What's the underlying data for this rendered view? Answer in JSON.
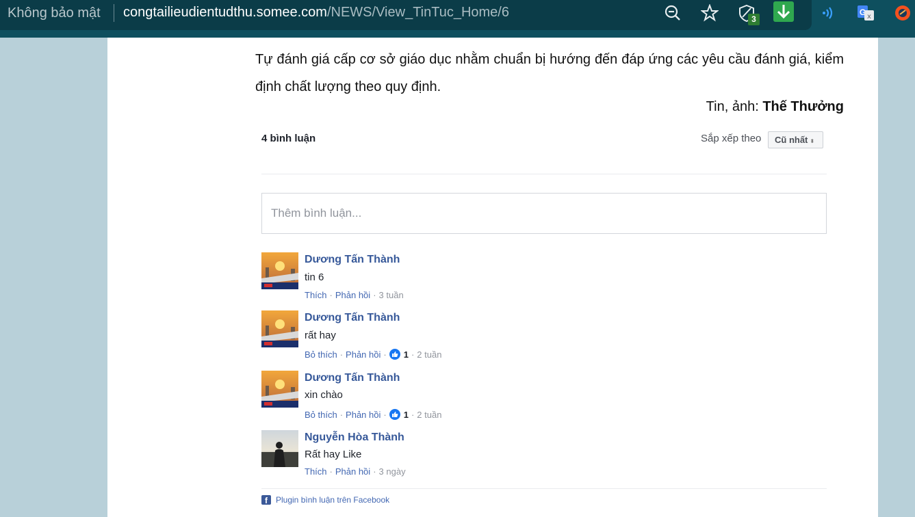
{
  "browser": {
    "security_label": "Không bảo mật",
    "url_host": "congtailieudientudthu.somee.com",
    "url_path": "/NEWS/View_TinTuc_Home/6",
    "extension_badge": "3",
    "icons": [
      "zoom-out-icon",
      "star-icon",
      "shield-icon",
      "download-icon",
      "wifi-icon",
      "translate-icon",
      "profile-icon"
    ]
  },
  "article": {
    "text": "Tự đánh giá cấp cơ sở giáo dục nhằm chuẩn bị hướng đến đáp ứng các yêu cầu đánh giá, kiểm định chất lượng theo quy định.",
    "credit_prefix": "Tin, ảnh: ",
    "credit_author": "Thế Thưởng"
  },
  "comments_plugin": {
    "count_label": "4 bình luận",
    "sort_label": "Sắp xếp theo",
    "sort_value": "Cũ nhất",
    "input_placeholder": "Thêm bình luận...",
    "comments": [
      {
        "author": "Dương Tấn Thành",
        "text": "tin 6",
        "like_label": "Thích",
        "reply_label": "Phản hồi",
        "likes": "",
        "time": "3 tuần"
      },
      {
        "author": "Dương Tấn Thành",
        "text": "rất hay",
        "like_label": "Bỏ thích",
        "reply_label": "Phản hồi",
        "likes": "1",
        "time": "2 tuần"
      },
      {
        "author": "Dương Tấn Thành",
        "text": "xin chào",
        "like_label": "Bỏ thích",
        "reply_label": "Phản hồi",
        "likes": "1",
        "time": "2 tuần"
      },
      {
        "author": "Nguyễn Hòa Thành",
        "text": "Rất hay Like",
        "like_label": "Thích",
        "reply_label": "Phản hồi",
        "likes": "",
        "time": "3 ngày"
      }
    ],
    "footer_label": "Plugin bình luận trên Facebook"
  },
  "colors": {
    "page_bg": "#b8d0d9",
    "toolbar_bg": "#0e4f5e",
    "link_blue": "#365899",
    "fb_blue": "#4267b2"
  }
}
